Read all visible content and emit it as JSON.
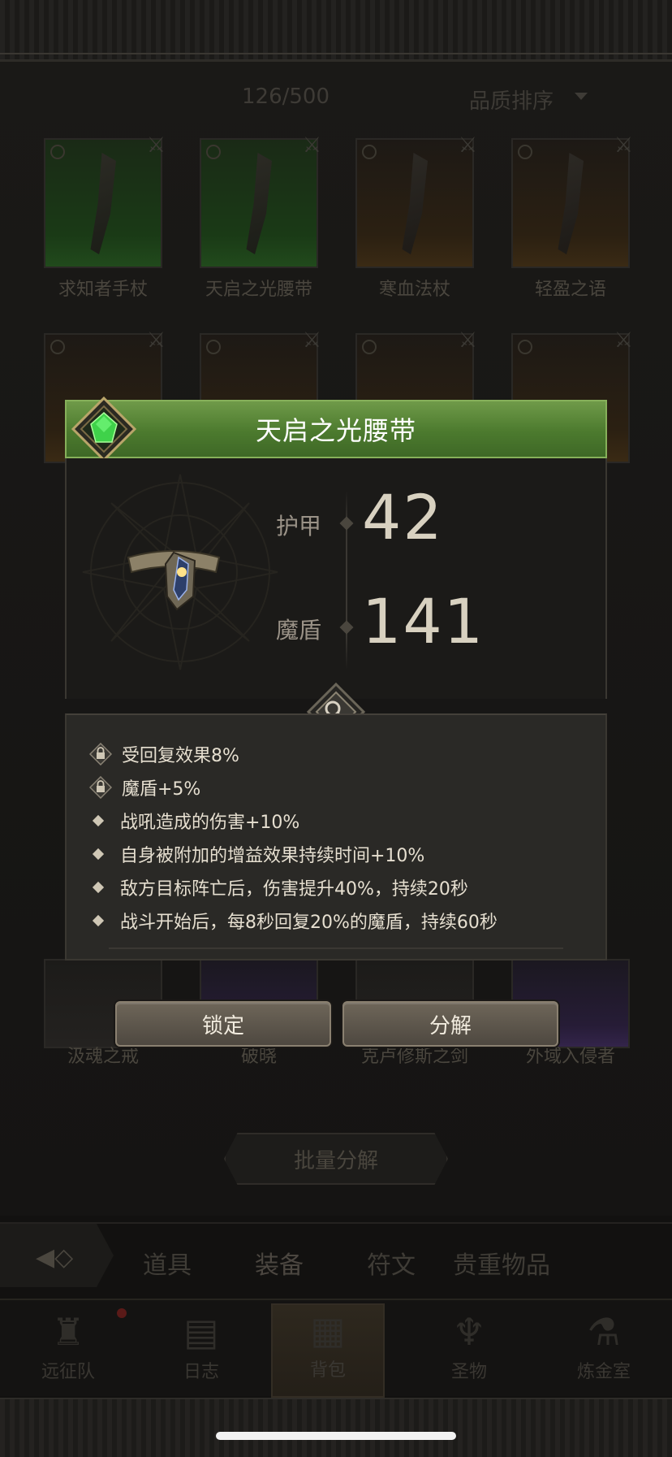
{
  "inventory": {
    "count": "126/500",
    "sort_label": "品质排序",
    "items": [
      {
        "name": "求知者手杖",
        "rarity": "green"
      },
      {
        "name": "天启之光腰带",
        "rarity": "green"
      },
      {
        "name": "寒血法杖",
        "rarity": "orange"
      },
      {
        "name": "轻盈之语",
        "rarity": "orange"
      },
      {
        "name": "",
        "rarity": "orange"
      },
      {
        "name": "",
        "rarity": "orange"
      },
      {
        "name": "",
        "rarity": "orange"
      },
      {
        "name": "",
        "rarity": "orange"
      },
      {
        "name": "汲魂之戒",
        "rarity": "gray"
      },
      {
        "name": "破晓",
        "rarity": "purple"
      },
      {
        "name": "克卢修斯之剑",
        "rarity": "gray"
      },
      {
        "name": "外域入侵者",
        "rarity": "purple"
      }
    ],
    "batch_button": "批量分解"
  },
  "categories": {
    "tabs": [
      {
        "label": "道具"
      },
      {
        "label": "装备",
        "active": true
      },
      {
        "label": "符文"
      },
      {
        "label": "贵重物品"
      }
    ]
  },
  "nav": {
    "items": [
      {
        "label": "远征队",
        "icon": "viking-helmet-icon"
      },
      {
        "label": "日志",
        "icon": "scroll-icon"
      },
      {
        "label": "背包",
        "icon": "backpack-icon",
        "active": true
      },
      {
        "label": "圣物",
        "icon": "chalice-icon"
      },
      {
        "label": "炼金室",
        "icon": "alchemy-icon"
      }
    ]
  },
  "popup": {
    "title": "天启之光腰带",
    "stats": [
      {
        "label": "护甲",
        "value": "42"
      },
      {
        "label": "魔盾",
        "value": "141"
      }
    ],
    "affixes": [
      {
        "text": "受回复效果8%",
        "locked": true
      },
      {
        "text": "魔盾+5%",
        "locked": true
      },
      {
        "text": "战吼造成的伤害+10%",
        "locked": false
      },
      {
        "text": "自身被附加的增益效果持续时间+10%",
        "locked": false
      },
      {
        "text": "敌方目标阵亡后，伤害提升40%，持续20秒",
        "locked": false
      },
      {
        "text": "战斗开始后，每8秒回复20%的魔盾，持续60秒",
        "locked": false
      }
    ],
    "lock_button": "锁定",
    "disassemble_button": "分解"
  },
  "colors": {
    "header_green": "#4c7a2e",
    "gem_green": "#3fd24a",
    "button_bg": "#5e574c"
  }
}
